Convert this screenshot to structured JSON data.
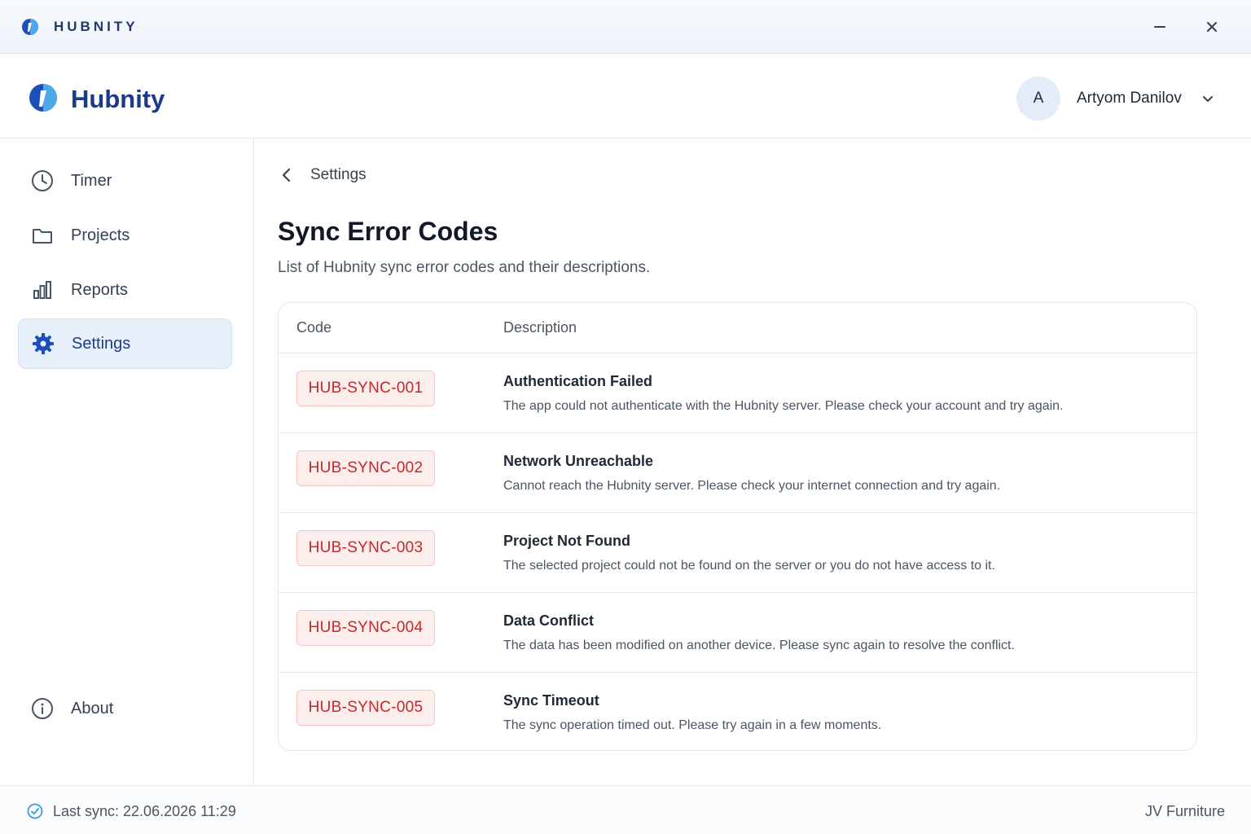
{
  "titlebar": {
    "title": "HUBNITY"
  },
  "header": {
    "brand": "Hubnity",
    "user": {
      "initial": "A",
      "name": "Artyom Danilov"
    }
  },
  "sidebar": {
    "items": [
      {
        "label": "Timer",
        "icon": "clock-icon"
      },
      {
        "label": "Projects",
        "icon": "folder-icon"
      },
      {
        "label": "Reports",
        "icon": "bar-chart-icon"
      },
      {
        "label": "Settings",
        "icon": "gear-icon",
        "active": true
      }
    ],
    "about": {
      "label": "About",
      "icon": "info-icon"
    }
  },
  "main": {
    "breadcrumb": "Settings",
    "title": "Sync Error Codes",
    "subtitle": "List of Hubnity sync error codes and their descriptions.",
    "table": {
      "headers": {
        "code": "Code",
        "description": "Description"
      },
      "rows": [
        {
          "code": "HUB-SYNC-001",
          "title": "Authentication Failed",
          "description": "The app could not authenticate with the Hubnity server. Please check your account and try again."
        },
        {
          "code": "HUB-SYNC-002",
          "title": "Network Unreachable",
          "description": "Cannot reach the Hubnity server. Please check your internet connection and try again."
        },
        {
          "code": "HUB-SYNC-003",
          "title": "Project Not Found",
          "description": "The selected project could not be found on the server or you do not have access to it."
        },
        {
          "code": "HUB-SYNC-004",
          "title": "Data Conflict",
          "description": "The data has been modified on another device. Please sync again to resolve the conflict."
        },
        {
          "code": "HUB-SYNC-005",
          "title": "Sync Timeout",
          "description": "The sync operation timed out. Please try again in a few moments."
        }
      ]
    }
  },
  "footer": {
    "last_sync": "Last sync: 22.06.2026 11:29",
    "company": "JV Furniture"
  },
  "colors": {
    "brand": "#1c3a8a",
    "accent_light": "#e8f0fc",
    "error_text": "#c62828",
    "error_bg": "#fdeeee",
    "sync_ok": "#3b9bd8"
  }
}
